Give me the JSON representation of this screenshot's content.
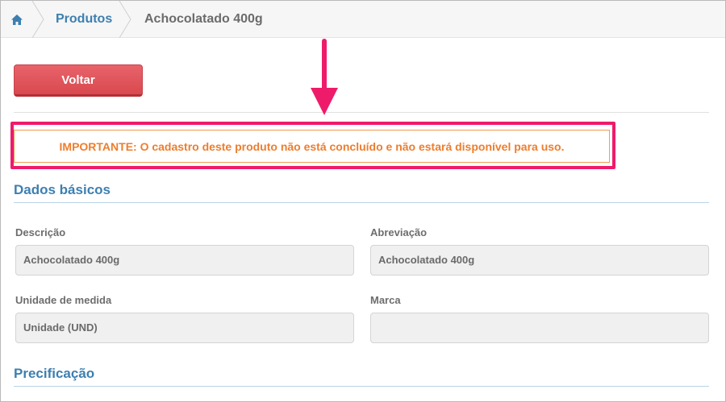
{
  "breadcrumb": {
    "home_icon": "home-icon",
    "items": [
      "Produtos",
      "Achocolatado 400g"
    ]
  },
  "actions": {
    "back_label": "Voltar"
  },
  "alert": {
    "text": "IMPORTANTE: O cadastro deste produto não está concluído e não estará disponível para uso.",
    "color": "#ee7d2d",
    "border_color": "#f39a52"
  },
  "annotation": {
    "arrow_color": "#ee1b6a",
    "highlight_color": "#ee1b6a"
  },
  "sections": {
    "basic": {
      "title": "Dados básicos",
      "fields": {
        "descricao": {
          "label": "Descrição",
          "value": "Achocolatado 400g"
        },
        "abreviacao": {
          "label": "Abreviação",
          "value": "Achocolatado 400g"
        },
        "unidade": {
          "label": "Unidade de medida",
          "value": "Unidade (UND)"
        },
        "marca": {
          "label": "Marca",
          "value": ""
        }
      }
    },
    "spec": {
      "title": "Precificação"
    }
  },
  "colors": {
    "accent": "#3d7fb0",
    "danger": "#d8494f"
  }
}
